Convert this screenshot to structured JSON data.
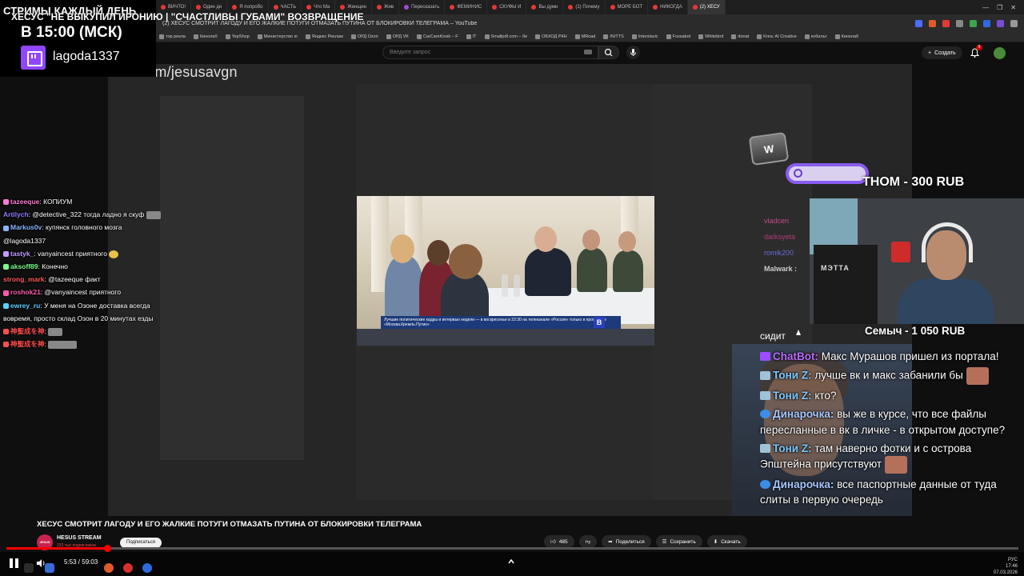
{
  "browser": {
    "tabs": [
      "ВИЧТО!",
      "Один дн",
      "Я попробо",
      "ЧАСТЬ",
      "Что Ма",
      "Женщин",
      "Жив",
      "Пересказать",
      "ФЕМИНИС",
      "СКУФЫ И",
      "Вы думн",
      "(1) Почему",
      "МОРЕ БОТ",
      "НИКОГДА",
      "(2) ХЕСУ"
    ],
    "page_title": "(2) ХЕСУС СМОТРИТ ЛАГОДУ И ЕГО ЖАЛКИЕ ПОТУГИ ОТМАЗАТЬ ПУТИНА ОТ БЛОКИРОВКИ ТЕЛЕГРАМА – YouTube",
    "retell_label": "Пересказать",
    "bookmarks": [
      "тор рекла",
      "Кинолаб",
      "YepShop",
      "Министерство ю",
      "Яндекс Реклам",
      "ОРД Ozon",
      "ОРД VK",
      "CarCareKiosk – F",
      "IT",
      "Smallpdf.com – бе",
      "ОБХОД РКН",
      "MRoad",
      "/N/TTS",
      "Interslavic",
      "Fossabot",
      "Whitebird",
      "donat",
      "Krea: AI Creative",
      "кобальт",
      "Кинолаб"
    ]
  },
  "youtube": {
    "search_placeholder": "Введите запрос",
    "create_label": "Создать",
    "bell_badge": "9"
  },
  "stream_overlay": {
    "banner_line1": "СТРИМЫ КАЖДЫЙ ДЕНЬ",
    "banner_line2": "В 15:00 (МСК)",
    "twitch_name": "lagoda1337",
    "video_title_overlay": "ХЕСУС \"НЕ ВЫКУПИЛ ИРОНИЮ | \"СЧАСТЛИВЫ ГУБАМИ\" ВОЗВРАЩЕНИЕ",
    "url_overlay": "ktok.com/jesusavgn",
    "news_ticker": "Лучшие политические кадры и интервью недели — в воскресенье в 22:30 на телеканале «Россия» только в программе «Москва.Кремль.Путин»",
    "news_logo": "В"
  },
  "left_chat": [
    {
      "user": "tazeeque",
      "text": "КОПИУМ",
      "color": "#ff7bd5"
    },
    {
      "user": "Artilych",
      "text": "@detective_322 тогда ладно я скуф",
      "color": "#8f7bff"
    },
    {
      "user": "Markus0v",
      "text": "купянск головного мозга @lagoda1337",
      "color": "#8ab4ff"
    },
    {
      "user": "tastyk_",
      "text": "vanyaincest приятного",
      "color": "#c59bff"
    },
    {
      "user": "aksoff89",
      "text": "Конечно",
      "color": "#7bff8e"
    },
    {
      "user": "strong_mark",
      "text": "@tazeeque факт",
      "color": "#ff5a5a"
    },
    {
      "user": "roshok21",
      "text": "@vanyaincest приятного",
      "color": "#ff5ab0"
    },
    {
      "user": "ewrey_ru",
      "text": "У меня на Озоне доставка всегда вовремя, просто склад Озон в 20 минутах езды",
      "color": "#5ad0ff"
    },
    {
      "user": "神聖成を神",
      "text": "",
      "color": "#ff4d4d"
    },
    {
      "user": "神聖成を神",
      "text": "",
      "color": "#ff4d4d"
    }
  ],
  "right_overlay": {
    "w_key": "W",
    "donation_top": "THOM - 300 RUB",
    "donation_bottom": "Семыч - 1 050 RUB",
    "mini_chat": [
      "vladcen",
      "",
      "darksyeta",
      "romik200",
      "Malwark :"
    ],
    "cam_panel_text": "МЭТТА",
    "sidit": "сидит"
  },
  "right_chat": [
    {
      "user": "ChatBot:",
      "text": " Макс Мурашов пришел из портала!",
      "color": "#b76bff",
      "icon_color": "#9c4dff",
      "emote": false
    },
    {
      "user": "Тони Z:",
      "text": " лучше вк и макс забанили бы",
      "color": "#7ec8ff",
      "icon_color": "#9fc3d8",
      "emote": true
    },
    {
      "user": "Тони Z:",
      "text": " кто?",
      "color": "#7ec8ff",
      "icon_color": "#9fc3d8",
      "emote": false
    },
    {
      "user": "Динарочка:",
      "text": " вы же в курсе, что все файлы пересланные в вк в личке - в открытом доступе?",
      "color": "#a8c8ff",
      "icon_color": "#3a8ee6",
      "emote": false
    },
    {
      "user": "Тони Z:",
      "text": " там наверно фотки и с острова Эпштейна присутствуют",
      "color": "#7ec8ff",
      "icon_color": "#9fc3d8",
      "emote": true
    },
    {
      "user": "Динарочка:",
      "text": " все паспортные данные от туда слиты в первую очередь",
      "color": "#a8c8ff",
      "icon_color": "#3a8ee6",
      "emote": false
    }
  ],
  "video_info": {
    "title": "ХЕСУС СМОТРИТ ЛАГОДУ И ЕГО ЖАЛКИЕ ПОТУГИ ОТМАЗАТЬ ПУТИНА ОТ БЛОКИРОВКИ ТЕЛЕГРАМА",
    "channel": "HESUS STREAM",
    "channel_avatar_text": "JESUS",
    "subscribers": "333 тыс подписчиков",
    "subscribe_label": "Подписаться",
    "likes": "485",
    "share_label": "Поделиться",
    "save_label": "Сохранить",
    "download_label": "Скачать"
  },
  "player": {
    "time": "5:53 / 59:03",
    "progress": 0.0997
  },
  "tray": {
    "lang": "РУС",
    "clock": "17:46",
    "date": "07.03.2026"
  }
}
